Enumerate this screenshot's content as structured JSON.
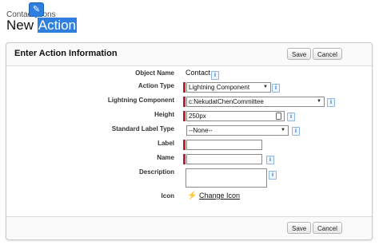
{
  "header": {
    "breadcrumb": "Contact",
    "breadcrumb_tail": "ons",
    "breadcrumb_icon_glyph": "✎",
    "title_prefix": "New ",
    "title_selected": "Action"
  },
  "form": {
    "section_title": "Enter Action Information",
    "save_label": "Save",
    "cancel_label": "Cancel",
    "fields": {
      "object_name": {
        "label": "Object Name",
        "value": "Contact"
      },
      "action_type": {
        "label": "Action Type",
        "value": "Lightning Component"
      },
      "lightning_component": {
        "label": "Lightning Component",
        "value": "c:NekudatChenCommittee"
      },
      "height": {
        "label": "Height",
        "value": "250px"
      },
      "standard_label_type": {
        "label": "Standard Label Type",
        "value": "--None--"
      },
      "label": {
        "label": "Label",
        "value": ""
      },
      "name": {
        "label": "Name",
        "value": ""
      },
      "description": {
        "label": "Description",
        "value": ""
      },
      "icon": {
        "label": "Icon",
        "link": "Change Icon"
      }
    },
    "info_glyph": "i",
    "dropdown_glyph": "▼"
  },
  "colors": {
    "accent": "#2f7fe0",
    "required_marker": "#c51e2e",
    "info_badge": "#1b6ac2"
  },
  "icons": {
    "breadcrumb": "edit-icon",
    "info": "info-icon",
    "dropdown": "chevron-down-icon",
    "icon_preview": "lightning-bolt-icon",
    "calculator": "calculator-icon"
  }
}
